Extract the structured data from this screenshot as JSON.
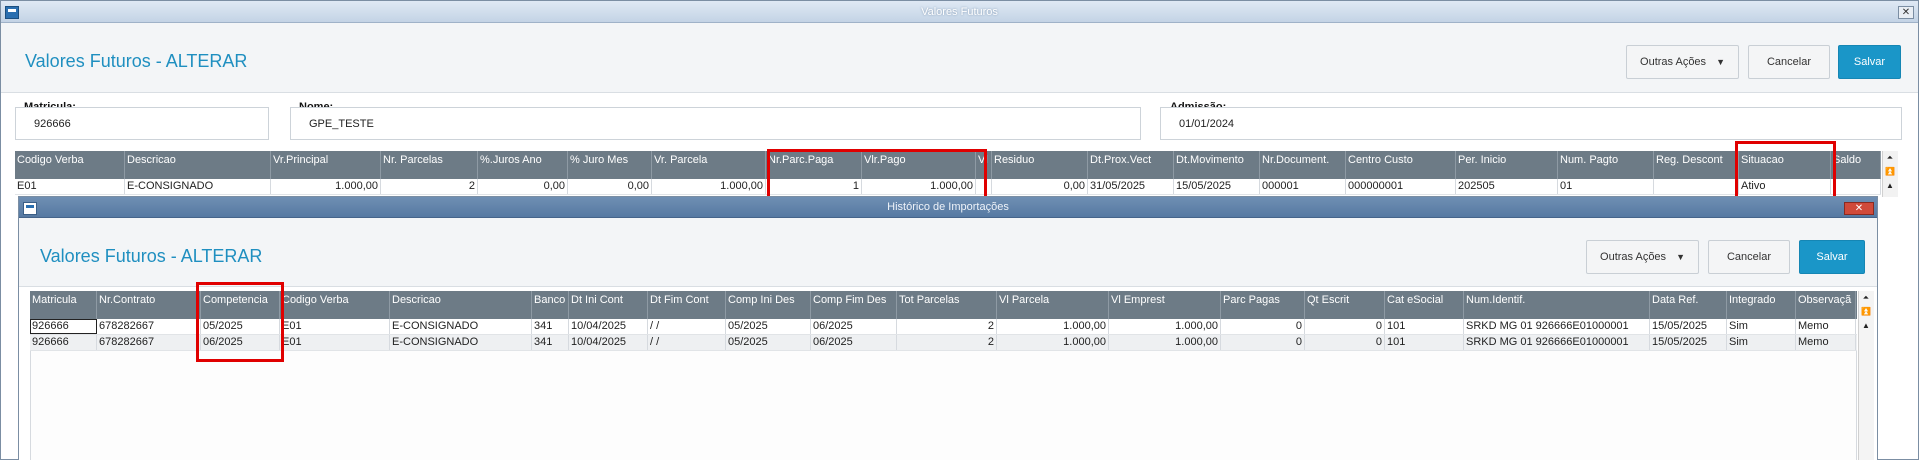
{
  "window": {
    "title": "Valores Futuros",
    "close_label": "✕"
  },
  "header": {
    "title": "Valores Futuros - ALTERAR",
    "more_actions": "Outras Ações",
    "cancel": "Cancelar",
    "save": "Salvar"
  },
  "fields": {
    "matricula_label": "Matricula:",
    "matricula_value": "926666",
    "nome_label": "Nome:",
    "nome_value": "GPE_TESTE",
    "admissao_label": "Admissão:",
    "admissao_value": "01/01/2024"
  },
  "main_grid": {
    "columns": [
      "Codigo Verba",
      "Descricao",
      "Vr.Principal",
      "Nr. Parcelas",
      "%.Juros Ano",
      "% Juro Mes",
      "Vr. Parcela",
      "Nr.Parc.Paga",
      "Vlr.Pago",
      "Vl",
      "Residuo",
      "Dt.Prox.Vect",
      "Dt.Movimento",
      "Nr.Document.",
      "Centro Custo",
      "Per. Inicio",
      "Num. Pagto",
      "Reg. Descont",
      "Situacao",
      "Saldo"
    ],
    "rows": [
      [
        "E01",
        "E-CONSIGNADO",
        "1.000,00",
        "2",
        "0,00",
        "0,00",
        "1.000,00",
        "1",
        "1.000,00",
        "",
        "0,00",
        "31/05/2025",
        "15/05/2025",
        "000001",
        "000000001",
        "202505",
        "01",
        "",
        "Ativo",
        ""
      ]
    ]
  },
  "modal": {
    "title": "Histórico de Importações",
    "page_title": "Valores Futuros - ALTERAR",
    "more_actions": "Outras Ações",
    "cancel": "Cancelar",
    "save": "Salvar",
    "columns": [
      "Matricula",
      "Nr.Contrato",
      "Competencia",
      "Codigo Verba",
      "Descricao",
      "Banco",
      "Dt Ini Cont",
      "Dt Fim Cont",
      "Comp Ini Des",
      "Comp Fim Des",
      "Tot Parcelas",
      "Vl Parcela",
      "Vl Emprest",
      "Parc Pagas",
      "Qt Escrit",
      "Cat eSocial",
      "Num.Identif.",
      "Data Ref.",
      "Integrado",
      "Observaçã"
    ],
    "rows": [
      [
        "926666",
        "678282667",
        "05/2025",
        "E01",
        "E-CONSIGNADO",
        "341",
        "10/04/2025",
        " /  /",
        "05/2025",
        "06/2025",
        "2",
        "1.000,00",
        "1.000,00",
        "0",
        "0",
        "101",
        "SRKD MG 01 926666E01000001",
        "15/05/2025",
        "Sim",
        "Memo"
      ],
      [
        "926666",
        "678282667",
        "06/2025",
        "E01",
        "E-CONSIGNADO",
        "341",
        "10/04/2025",
        " /  /",
        "05/2025",
        "06/2025",
        "2",
        "1.000,00",
        "1.000,00",
        "0",
        "0",
        "101",
        "SRKD MG 01 926666E01000001",
        "15/05/2025",
        "Sim",
        "Memo"
      ]
    ]
  },
  "colors": {
    "accent": "#1a96c8",
    "title_blue": "#1f8fc0",
    "grid_header": "#6d7b86",
    "highlight": "#e00000"
  }
}
